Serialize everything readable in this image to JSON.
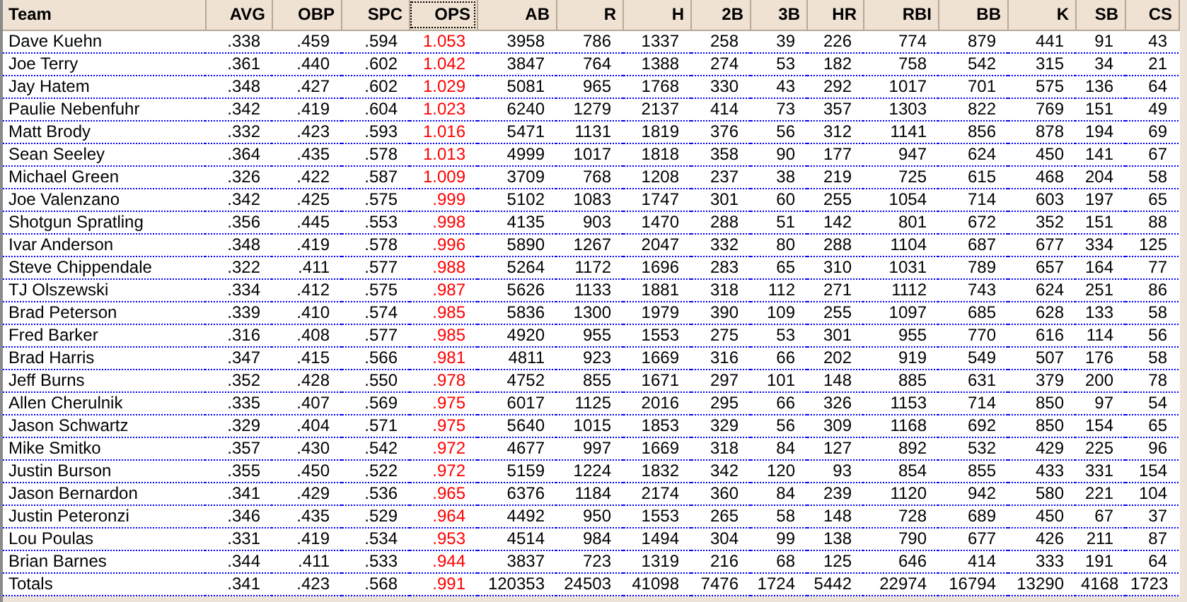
{
  "columns": [
    {
      "label": "Team",
      "kind": "name",
      "selected": false,
      "highlighted": false
    },
    {
      "label": "AVG",
      "kind": "number",
      "selected": false,
      "highlighted": false
    },
    {
      "label": "OBP",
      "kind": "number",
      "selected": false,
      "highlighted": false
    },
    {
      "label": "SPC",
      "kind": "number",
      "selected": false,
      "highlighted": false
    },
    {
      "label": "OPS",
      "kind": "number",
      "selected": true,
      "highlighted": true
    },
    {
      "label": "AB",
      "kind": "number",
      "selected": false,
      "highlighted": false
    },
    {
      "label": "R",
      "kind": "number",
      "selected": false,
      "highlighted": false
    },
    {
      "label": "H",
      "kind": "number",
      "selected": false,
      "highlighted": false
    },
    {
      "label": "2B",
      "kind": "number",
      "selected": false,
      "highlighted": false
    },
    {
      "label": "3B",
      "kind": "number",
      "selected": false,
      "highlighted": false
    },
    {
      "label": "HR",
      "kind": "number",
      "selected": false,
      "highlighted": false
    },
    {
      "label": "RBI",
      "kind": "number",
      "selected": false,
      "highlighted": false
    },
    {
      "label": "BB",
      "kind": "number",
      "selected": false,
      "highlighted": false
    },
    {
      "label": "K",
      "kind": "number",
      "selected": false,
      "highlighted": false
    },
    {
      "label": "SB",
      "kind": "number",
      "selected": false,
      "highlighted": false
    },
    {
      "label": "CS",
      "kind": "number",
      "selected": false,
      "highlighted": false
    }
  ],
  "rows": [
    [
      "Dave Kuehn",
      ".338",
      ".459",
      ".594",
      "1.053",
      "3958",
      "786",
      "1337",
      "258",
      "39",
      "226",
      "774",
      "879",
      "441",
      "91",
      "43"
    ],
    [
      "Joe Terry",
      ".361",
      ".440",
      ".602",
      "1.042",
      "3847",
      "764",
      "1388",
      "274",
      "53",
      "182",
      "758",
      "542",
      "315",
      "34",
      "21"
    ],
    [
      "Jay Hatem",
      ".348",
      ".427",
      ".602",
      "1.029",
      "5081",
      "965",
      "1768",
      "330",
      "43",
      "292",
      "1017",
      "701",
      "575",
      "136",
      "64"
    ],
    [
      "Paulie Nebenfuhr",
      ".342",
      ".419",
      ".604",
      "1.023",
      "6240",
      "1279",
      "2137",
      "414",
      "73",
      "357",
      "1303",
      "822",
      "769",
      "151",
      "49"
    ],
    [
      "Matt Brody",
      ".332",
      ".423",
      ".593",
      "1.016",
      "5471",
      "1131",
      "1819",
      "376",
      "56",
      "312",
      "1141",
      "856",
      "878",
      "194",
      "69"
    ],
    [
      "Sean Seeley",
      ".364",
      ".435",
      ".578",
      "1.013",
      "4999",
      "1017",
      "1818",
      "358",
      "90",
      "177",
      "947",
      "624",
      "450",
      "141",
      "67"
    ],
    [
      "Michael Green",
      ".326",
      ".422",
      ".587",
      "1.009",
      "3709",
      "768",
      "1208",
      "237",
      "38",
      "219",
      "725",
      "615",
      "468",
      "204",
      "58"
    ],
    [
      "Joe Valenzano",
      ".342",
      ".425",
      ".575",
      ".999",
      "5102",
      "1083",
      "1747",
      "301",
      "60",
      "255",
      "1054",
      "714",
      "603",
      "197",
      "65"
    ],
    [
      "Shotgun Spratling",
      ".356",
      ".445",
      ".553",
      ".998",
      "4135",
      "903",
      "1470",
      "288",
      "51",
      "142",
      "801",
      "672",
      "352",
      "151",
      "88"
    ],
    [
      "Ivar Anderson",
      ".348",
      ".419",
      ".578",
      ".996",
      "5890",
      "1267",
      "2047",
      "332",
      "80",
      "288",
      "1104",
      "687",
      "677",
      "334",
      "125"
    ],
    [
      "Steve Chippendale",
      ".322",
      ".411",
      ".577",
      ".988",
      "5264",
      "1172",
      "1696",
      "283",
      "65",
      "310",
      "1031",
      "789",
      "657",
      "164",
      "77"
    ],
    [
      "TJ Olszewski",
      ".334",
      ".412",
      ".575",
      ".987",
      "5626",
      "1133",
      "1881",
      "318",
      "112",
      "271",
      "1112",
      "743",
      "624",
      "251",
      "86"
    ],
    [
      "Brad Peterson",
      ".339",
      ".410",
      ".574",
      ".985",
      "5836",
      "1300",
      "1979",
      "390",
      "109",
      "255",
      "1097",
      "685",
      "628",
      "133",
      "58"
    ],
    [
      "Fred Barker",
      ".316",
      ".408",
      ".577",
      ".985",
      "4920",
      "955",
      "1553",
      "275",
      "53",
      "301",
      "955",
      "770",
      "616",
      "114",
      "56"
    ],
    [
      "Brad Harris",
      ".347",
      ".415",
      ".566",
      ".981",
      "4811",
      "923",
      "1669",
      "316",
      "66",
      "202",
      "919",
      "549",
      "507",
      "176",
      "58"
    ],
    [
      "Jeff Burns",
      ".352",
      ".428",
      ".550",
      ".978",
      "4752",
      "855",
      "1671",
      "297",
      "101",
      "148",
      "885",
      "631",
      "379",
      "200",
      "78"
    ],
    [
      "Allen Cherulnik",
      ".335",
      ".407",
      ".569",
      ".975",
      "6017",
      "1125",
      "2016",
      "295",
      "66",
      "326",
      "1153",
      "714",
      "850",
      "97",
      "54"
    ],
    [
      "Jason Schwartz",
      ".329",
      ".404",
      ".571",
      ".975",
      "5640",
      "1015",
      "1853",
      "329",
      "56",
      "309",
      "1168",
      "692",
      "850",
      "154",
      "65"
    ],
    [
      "Mike Smitko",
      ".357",
      ".430",
      ".542",
      ".972",
      "4677",
      "997",
      "1669",
      "318",
      "84",
      "127",
      "892",
      "532",
      "429",
      "225",
      "96"
    ],
    [
      "Justin Burson",
      ".355",
      ".450",
      ".522",
      ".972",
      "5159",
      "1224",
      "1832",
      "342",
      "120",
      "93",
      "854",
      "855",
      "433",
      "331",
      "154"
    ],
    [
      "Jason Bernardon",
      ".341",
      ".429",
      ".536",
      ".965",
      "6376",
      "1184",
      "2174",
      "360",
      "84",
      "239",
      "1120",
      "942",
      "580",
      "221",
      "104"
    ],
    [
      "Justin Peteronzi",
      ".346",
      ".435",
      ".529",
      ".964",
      "4492",
      "950",
      "1553",
      "265",
      "58",
      "148",
      "728",
      "689",
      "450",
      "67",
      "37"
    ],
    [
      "Lou Poulas",
      ".331",
      ".419",
      ".534",
      ".953",
      "4514",
      "984",
      "1494",
      "304",
      "99",
      "138",
      "790",
      "677",
      "426",
      "211",
      "87"
    ],
    [
      "Brian Barnes",
      ".344",
      ".411",
      ".533",
      ".944",
      "3837",
      "723",
      "1319",
      "216",
      "68",
      "125",
      "646",
      "414",
      "333",
      "191",
      "64"
    ],
    [
      "Totals",
      ".341",
      ".423",
      ".568",
      ".991",
      "120353",
      "24503",
      "41098",
      "7476",
      "1724",
      "5442",
      "22974",
      "16794",
      "13290",
      "4168",
      "1723"
    ]
  ]
}
